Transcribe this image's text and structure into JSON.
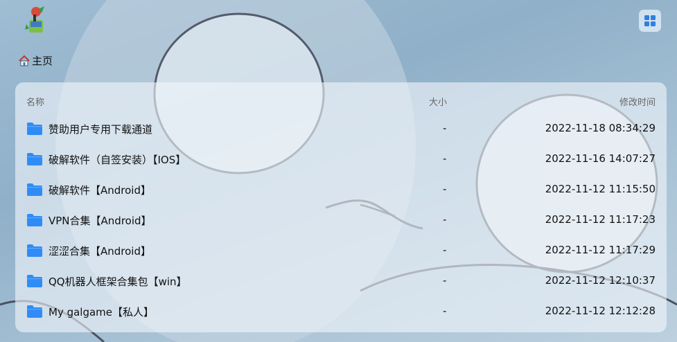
{
  "breadcrumb": {
    "home_label": "主页"
  },
  "table": {
    "headers": {
      "name": "名称",
      "size": "大小",
      "modified": "修改时间"
    },
    "rows": [
      {
        "name": "赞助用户专用下载通道",
        "size": "-",
        "modified": "2022-11-18 08:34:29"
      },
      {
        "name": "破解软件（自签安装）【IOS】",
        "size": "-",
        "modified": "2022-11-16 14:07:27"
      },
      {
        "name": "破解软件【Android】",
        "size": "-",
        "modified": "2022-11-12 11:15:50"
      },
      {
        "name": "VPN合集【Android】",
        "size": "-",
        "modified": "2022-11-12 11:17:23"
      },
      {
        "name": "涩涩合集【Android】",
        "size": "-",
        "modified": "2022-11-12 11:17:29"
      },
      {
        "name": "QQ机器人框架合集包【win】",
        "size": "-",
        "modified": "2022-11-12 12:10:37"
      },
      {
        "name": "My galgame【私人】",
        "size": "-",
        "modified": "2022-11-12 12:12:28"
      }
    ]
  },
  "icons": {
    "logo": "logo-icon",
    "menu": "grid-menu-icon",
    "home": "home-icon",
    "folder": "folder-icon"
  },
  "colors": {
    "folder": "#2f8cf6",
    "menu_icon": "#2f7fe0"
  }
}
